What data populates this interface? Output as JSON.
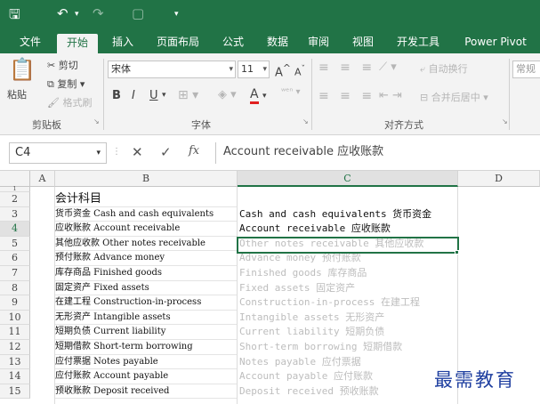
{
  "quick_access": {
    "save_icon": "save-icon",
    "undo_icon": "undo-icon",
    "redo_icon": "redo-icon",
    "preview_icon": "print-preview-icon",
    "customize_icon": "customize-icon"
  },
  "tabs": [
    "文件",
    "开始",
    "插入",
    "页面布局",
    "公式",
    "数据",
    "审阅",
    "视图",
    "开发工具",
    "Power Pivot"
  ],
  "active_tab": "开始",
  "ribbon": {
    "clipboard": {
      "paste": "粘贴",
      "cut": "剪切",
      "copy": "复制",
      "format_painter": "格式刷",
      "group_label": "剪贴板"
    },
    "font": {
      "font_name": "宋体",
      "font_size": "11",
      "grow": "A",
      "shrink": "A",
      "bold": "B",
      "italic": "I",
      "underline": "U",
      "font_color": "A",
      "group_label": "字体"
    },
    "alignment": {
      "wrap": "自动换行",
      "merge": "合并后居中",
      "group_label": "对齐方式"
    },
    "number": {
      "format": "常规"
    }
  },
  "formula_bar": {
    "name_box": "C4",
    "cancel": "✕",
    "enter": "✓",
    "fx": "fx",
    "content": "Account receivable 应收账款"
  },
  "sheet": {
    "columns": [
      "A",
      "B",
      "C",
      "D"
    ],
    "selected_column": "C",
    "selected_row": "4",
    "rows": [
      {
        "num": "2",
        "b": "会计科目",
        "c": ""
      },
      {
        "num": "3",
        "b": "货币资金 Cash and cash equivalents",
        "c": "Cash and cash equivalents 货币资金"
      },
      {
        "num": "4",
        "b": "应收账款 Account receivable",
        "c": "Account receivable 应收账款"
      },
      {
        "num": "5",
        "b": "其他应收款 Other notes receivable",
        "c": "Other notes receivable 其他应收款"
      },
      {
        "num": "6",
        "b": "预付账款 Advance money",
        "c": "Advance money 预付账款"
      },
      {
        "num": "7",
        "b": "库存商品 Finished goods",
        "c": "Finished goods 库存商品"
      },
      {
        "num": "8",
        "b": "固定资产 Fixed assets",
        "c": "Fixed assets 固定资产"
      },
      {
        "num": "9",
        "b": "在建工程 Construction-in-process",
        "c": "Construction-in-process 在建工程"
      },
      {
        "num": "10",
        "b": "无形资产 Intangible assets",
        "c": "Intangible assets 无形资产"
      },
      {
        "num": "11",
        "b": "短期负债 Current liability",
        "c": "Current liability 短期负债"
      },
      {
        "num": "12",
        "b": "短期借款 Short-term borrowing",
        "c": "Short-term borrowing 短期借款"
      },
      {
        "num": "13",
        "b": "应付票据 Notes payable",
        "c": "Notes payable 应付票据"
      },
      {
        "num": "14",
        "b": "应付账款 Account payable",
        "c": "Account payable 应付账款"
      },
      {
        "num": "15",
        "b": "预收账款 Deposit received",
        "c": "Deposit received 预收账款"
      }
    ]
  },
  "watermark": "最需教育"
}
